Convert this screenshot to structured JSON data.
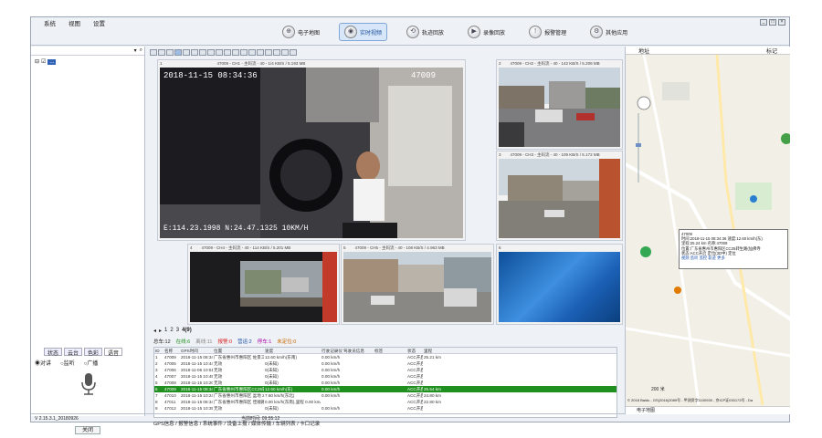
{
  "menu": [
    "系统",
    "视图",
    "设置"
  ],
  "main_tabs": [
    {
      "label": "电子地图",
      "icon": "map-icon"
    },
    {
      "label": "实时视频",
      "icon": "video-icon",
      "active": true
    },
    {
      "label": "轨迹回放",
      "icon": "track-icon"
    },
    {
      "label": "录像回放",
      "icon": "replay-icon"
    },
    {
      "label": "报警管理",
      "icon": "alarm-icon"
    },
    {
      "label": "其他应用",
      "icon": "apps-icon"
    }
  ],
  "tree": {
    "root_label": "..."
  },
  "left_tabs": [
    "状态",
    "云台",
    "色彩",
    "语音"
  ],
  "radios": [
    "对讲",
    "监听",
    "广播"
  ],
  "close_button": "关闭",
  "version": "V 2.15.3.1_20180926",
  "video_cells": [
    {
      "index": "1",
      "header": "47009 - CH1 - 主码流 - 40 - 1/4 KB/S / 5.193 MB",
      "osd_time": "2018-11-15 08:34:36",
      "osd_id": "47009",
      "osd_coords": "E:114.23.1998 N:24.47.1325 10KM/H"
    },
    {
      "index": "2",
      "header": "47009 - CH2 - 主码流 - 40 - 142 KB/S / 5.208 MB"
    },
    {
      "index": "3",
      "header": "47009 - CH3 - 主码流 - 40 - 109 KB/S / 5.172 MB"
    },
    {
      "index": "4",
      "header": "47009 - CH4 - 主码流 - 40 - 114 KB/S / 5.201 MB"
    },
    {
      "index": "5",
      "header": "47009 - CH5 - 主码流 - 40 - 108 KB/S / 4.963 MB"
    },
    {
      "index": "6",
      "header": ""
    }
  ],
  "page_tabs": [
    "1",
    "2",
    "3",
    "4(9)"
  ],
  "stats": [
    {
      "label": "总车:12",
      "color": "#222"
    },
    {
      "label": "在线:6",
      "color": "#1f8f1f"
    },
    {
      "label": "离线:11",
      "color": "#888"
    },
    {
      "label": "报警:0",
      "color": "#d22"
    },
    {
      "label": "营运:2",
      "color": "#1b4ea8"
    },
    {
      "label": "停车:1",
      "color": "#a0a"
    },
    {
      "label": "未定位:0",
      "color": "#c60"
    }
  ],
  "table": {
    "headers": [
      "ID",
      "名称",
      "GPS时间",
      "位置",
      "速度",
      "行驶记录仪速度",
      "驾驶员信息",
      "标签",
      "状态",
      "里程"
    ],
    "rows": [
      [
        "1",
        "47009",
        "2018-11-15 08:34:36",
        "广东省惠州市惠阳区 佐景工业园北 (57米",
        "12.60 km/h(东南)",
        "0.00 km/h",
        "",
        "",
        "ACC开启, 定位(3D中)",
        "25.21 km"
      ],
      [
        "2",
        "47005",
        "2018-11-15 10:44:06",
        "无效",
        "0(未知)",
        "0.00 km/h",
        "",
        "",
        "ACC开启, 未定位, 定位",
        ""
      ],
      [
        "3",
        "47006",
        "2018-11-06 10:51:21",
        "无效",
        "0(未知)",
        "0.00 km/h",
        "",
        "",
        "ACC开启, 未定位, 定位",
        ""
      ],
      [
        "4",
        "47007",
        "2018-11-15 10:45:02",
        "无效",
        "0(未知)",
        "0.00 km/h",
        "",
        "",
        "ACC开启, 未定位, 定位",
        ""
      ],
      [
        "5",
        "47008",
        "2018-11-15 10:20:57",
        "无效",
        "0(未知)",
        "0.00 km/h",
        "",
        "",
        "ACC开启, 未定位, 定位",
        ""
      ],
      [
        "6",
        "47009",
        "2018-11-15 08:34:36",
        "广东省惠州市惠阳区CC25转生路(仙佛寺往东",
        "12.60 km/h(东)",
        "0.00 km/h",
        "",
        "",
        "ACC开启, 定位(3D中)",
        "25.54 km"
      ],
      [
        "7",
        "47010",
        "2018-11-15 10:24:55",
        "广东省惠州市惠阳区 盆地 242米",
        "7.60 km/h(东北)",
        "0.00 km/h",
        "",
        "",
        "ACC开启, 定位(3D中)",
        "24.80 km"
      ],
      [
        "8",
        "47011",
        "2018-11-15 08:34:29",
        "广东省惠州市惠阳区 佳顺路242米",
        "0.00 km/h(东南),里程 0.00 km/h",
        "",
        "",
        "",
        "ACC开启, 超速(00:00:00)",
        "22.80 km"
      ],
      [
        "9",
        "47012",
        "2018-11-15 10:35:02",
        "无效",
        "0(未知)",
        "0.00 km/h",
        "",
        "",
        "ACC开启, 未定位, 定位",
        ""
      ]
    ],
    "highlight_row": 5
  },
  "bottom_tabs": [
    "GPS信息",
    "报警信息",
    "系统事件",
    "设备上报",
    "媒体传输",
    "车辆列表",
    "卡口记录"
  ],
  "status_bar": "当前时间: 09:55:12",
  "map": {
    "left_label": "地址",
    "right_label": "标记",
    "popup": {
      "line1": "47009",
      "line2": "时间:2018-11-15 08:34:36  速度:12.60 km/h(东)",
      "line3": "里程:25.24 km  名称:47009",
      "line4": "位置:广东省惠州市惠阳区CC25转生路(仙佛寺",
      "line5": "状态:ACC开启 定位(3D中) 定位",
      "links": "视频  监听  监控  轨迹  更多"
    },
    "copyright": "© 2018 Baidu - GS(2016)2089号 - 甲测资字1100930 - 京ICP证030173号 - Da",
    "footer_tab": "电子地图",
    "scale": "200 米"
  }
}
